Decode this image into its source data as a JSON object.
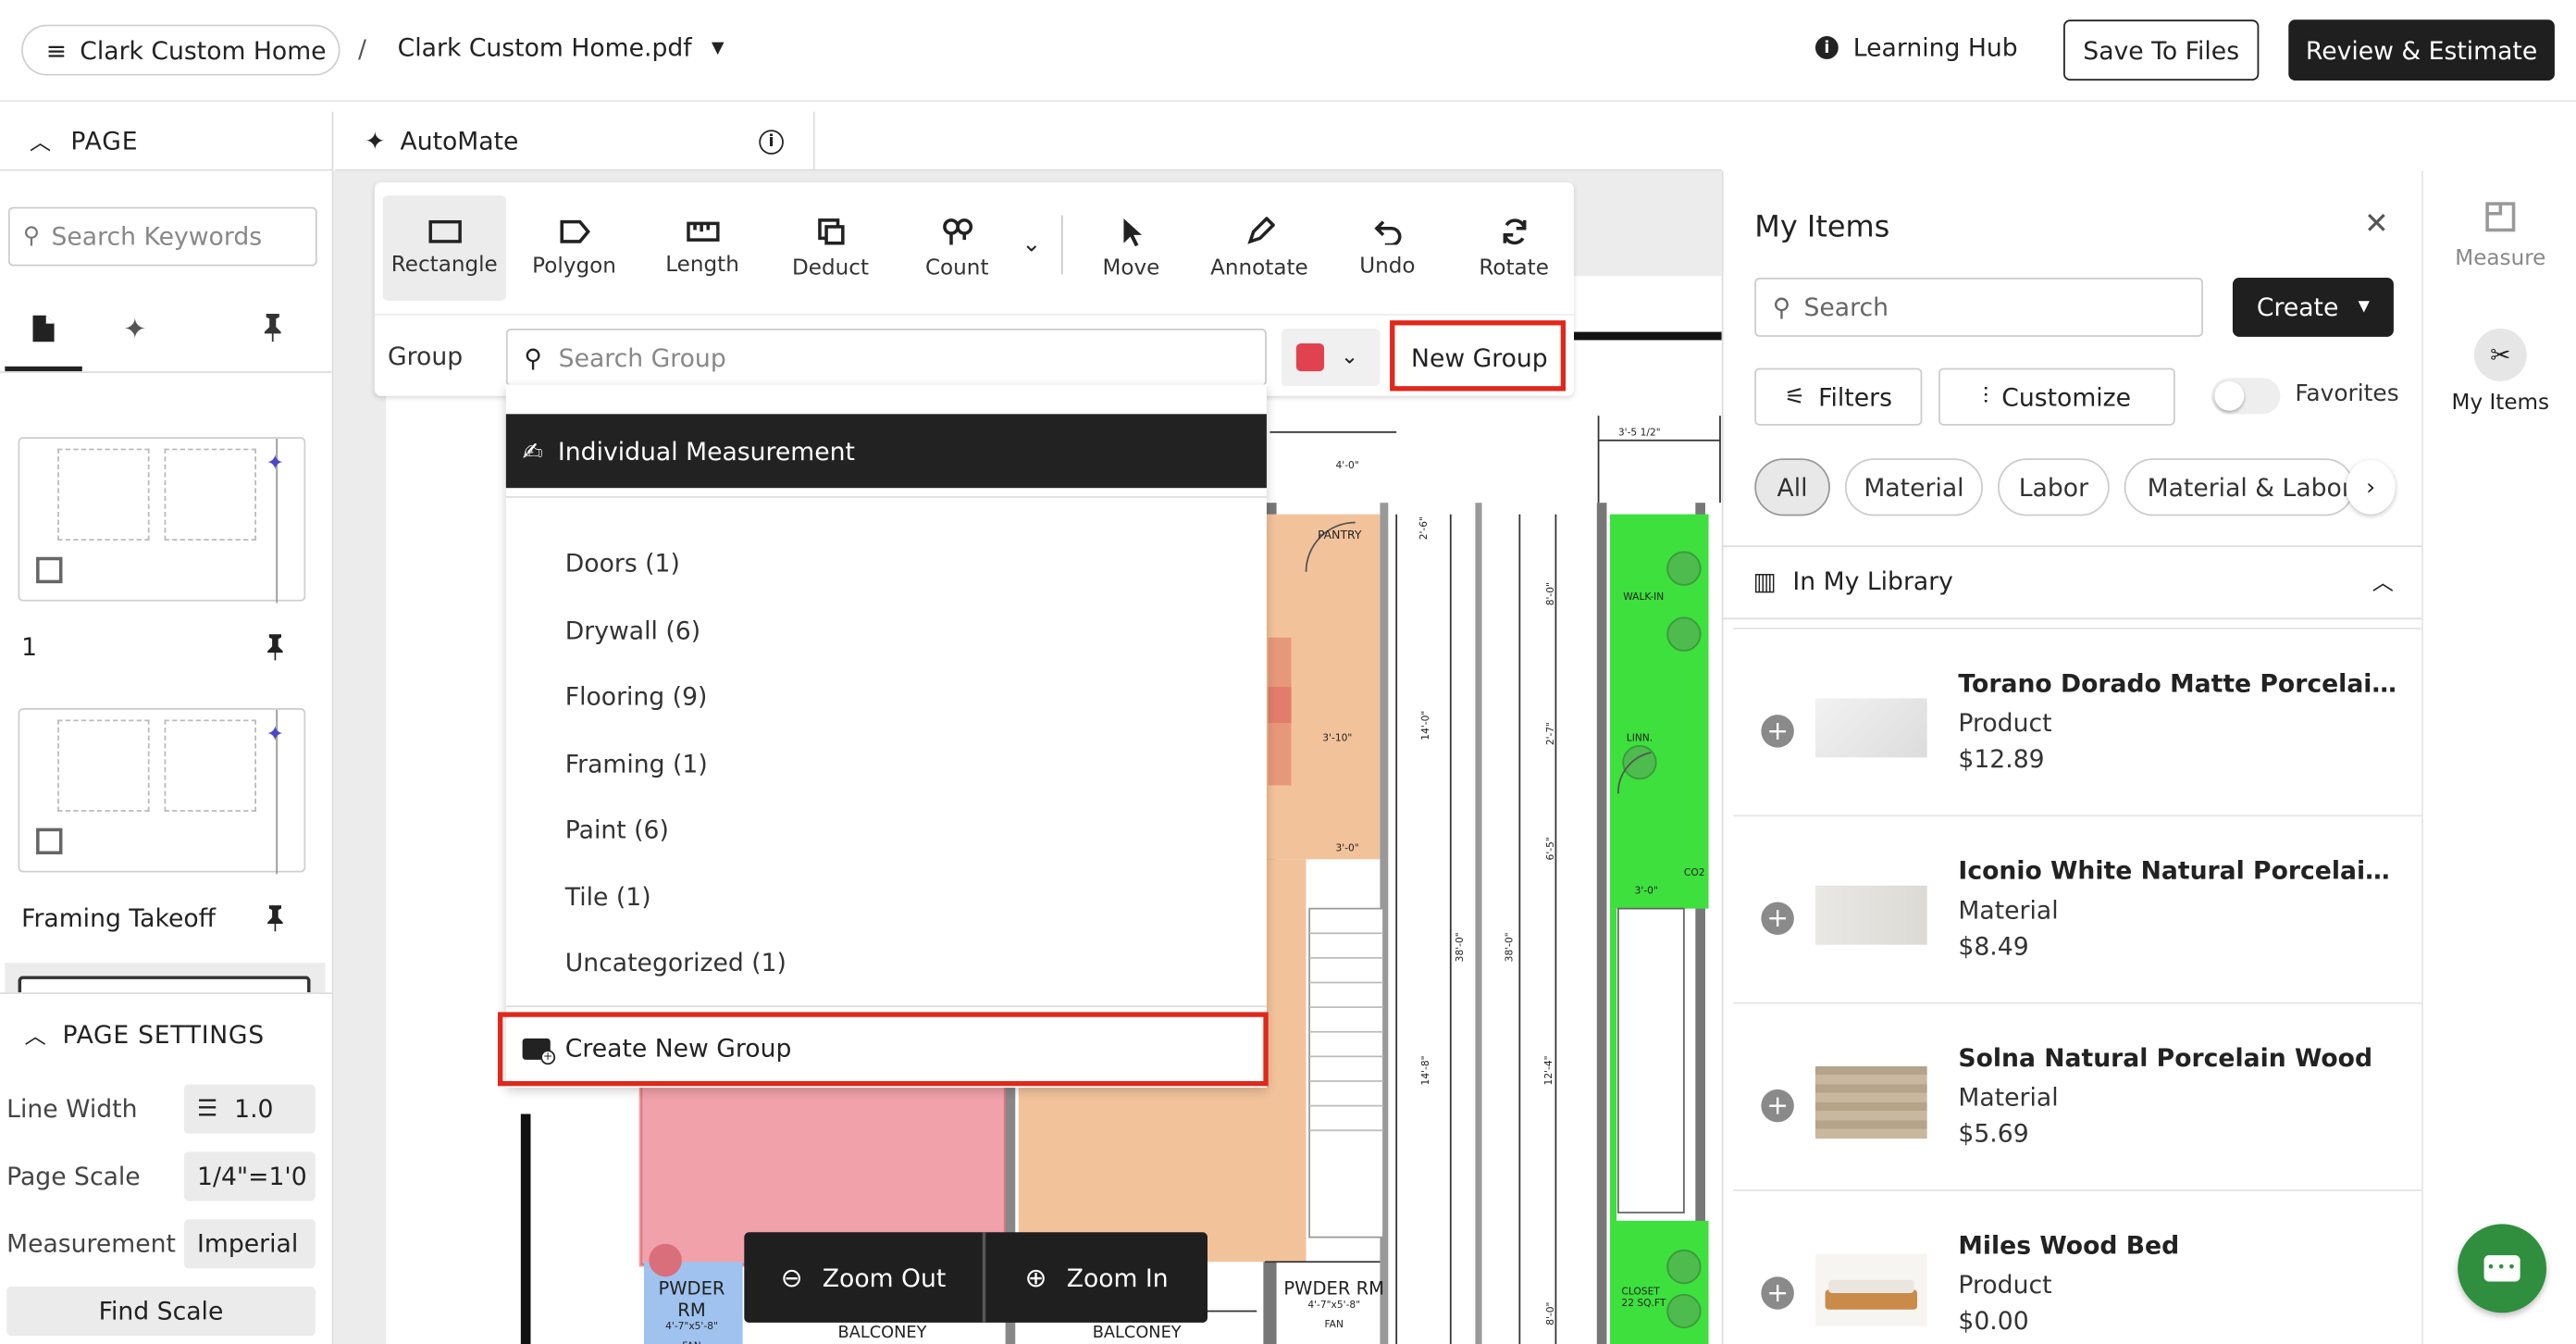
{
  "header": {
    "project_name": "Clark Custom Home",
    "separator": "/",
    "file_name": "Clark Custom Home.pdf",
    "learning_hub": "Learning Hub",
    "save_to_files": "Save To Files",
    "review_estimate": "Review & Estimate"
  },
  "left": {
    "page_section": "PAGE",
    "search_placeholder": "Search Keywords",
    "pages": [
      {
        "label": "1"
      },
      {
        "label": "Framing Takeoff"
      }
    ],
    "settings_title": "PAGE SETTINGS",
    "line_width_label": "Line Width",
    "line_width_value": "1.0",
    "page_scale_label": "Page Scale",
    "page_scale_value": "1/4\"=1'0",
    "measurement_label": "Measurement",
    "measurement_value": "Imperial",
    "find_scale": "Find Scale"
  },
  "automate": {
    "label": "AutoMate"
  },
  "toolbar": {
    "tools": [
      "Rectangle",
      "Polygon",
      "Length",
      "Deduct",
      "Count",
      "Move",
      "Annotate",
      "Undo",
      "Rotate"
    ],
    "group_label": "Group",
    "group_search_placeholder": "Search Group",
    "group_color": "#e0434f",
    "new_group": "New Group"
  },
  "group_dropdown": {
    "individual": "Individual Measurement",
    "groups": [
      "Doors (1)",
      "Drywall (6)",
      "Flooring (9)",
      "Framing (1)",
      "Paint (6)",
      "Tile (1)",
      "Uncategorized (1)"
    ],
    "create_new": "Create New Group"
  },
  "plan_labels": {
    "pantry": "PANTRY",
    "walkin": "WALK-IN",
    "linen": "LINN.",
    "co2": "CO2",
    "closet": "CLOSET\n22 SQ.FT",
    "pwder_left": "PWDER RM",
    "pwder_left_dim": "4'-7\"x5'-8\"",
    "pwder_right": "PWDER RM",
    "pwder_right_dim": "4'-7\"x5'-8\"",
    "fan": "FAN",
    "balcony1": "BALCONEY",
    "balcony2": "BALCONEY",
    "dim_top1": "4'-0\"",
    "dim_top2": "3'-5 1/2\"",
    "dim_310": "3'-10\"",
    "dim_30a": "3'-0\"",
    "dim_30b": "3'-0\"",
    "dim_140": "14'-0\"",
    "dim_148": "14'-8\"",
    "dim_380": "38'-0\"",
    "dim_380b": "38'-0\"",
    "dim_124": "12'-4\"",
    "dim_80": "8'-0\"",
    "dim_27": "2'-7\"",
    "dim_65": "6'-5\"",
    "dim_80b": "8'-0\"",
    "dim_26": "2'-6\""
  },
  "zoom": {
    "out": "Zoom Out",
    "in": "Zoom In"
  },
  "my_items": {
    "title": "My Items",
    "search_placeholder": "Search",
    "create": "Create",
    "filters": "Filters",
    "customize": "Customize",
    "favorites": "Favorites",
    "chips": [
      "All",
      "Material",
      "Labor",
      "Material & Labor"
    ],
    "library": "In My Library",
    "items": [
      {
        "name": "Torano Dorado Matte Porcelain Wall...",
        "type": "Product",
        "price": "$12.89"
      },
      {
        "name": "Iconio White Natural Porcelain Tile",
        "type": "Material",
        "price": "$8.49"
      },
      {
        "name": "Solna Natural Porcelain Wood",
        "type": "Material",
        "price": "$5.69"
      },
      {
        "name": "Miles Wood Bed",
        "type": "Product",
        "price": "$0.00"
      }
    ]
  },
  "rail": {
    "measure": "Measure",
    "my_items": "My Items"
  },
  "colors": {
    "accent_dark": "#1f1f1f",
    "highlight_red": "#e0281b",
    "chat_green": "#2f8f3e",
    "flooring_orange": "#f2c39b",
    "paint_green": "#3de03d",
    "pink": "#f0a1a9"
  }
}
